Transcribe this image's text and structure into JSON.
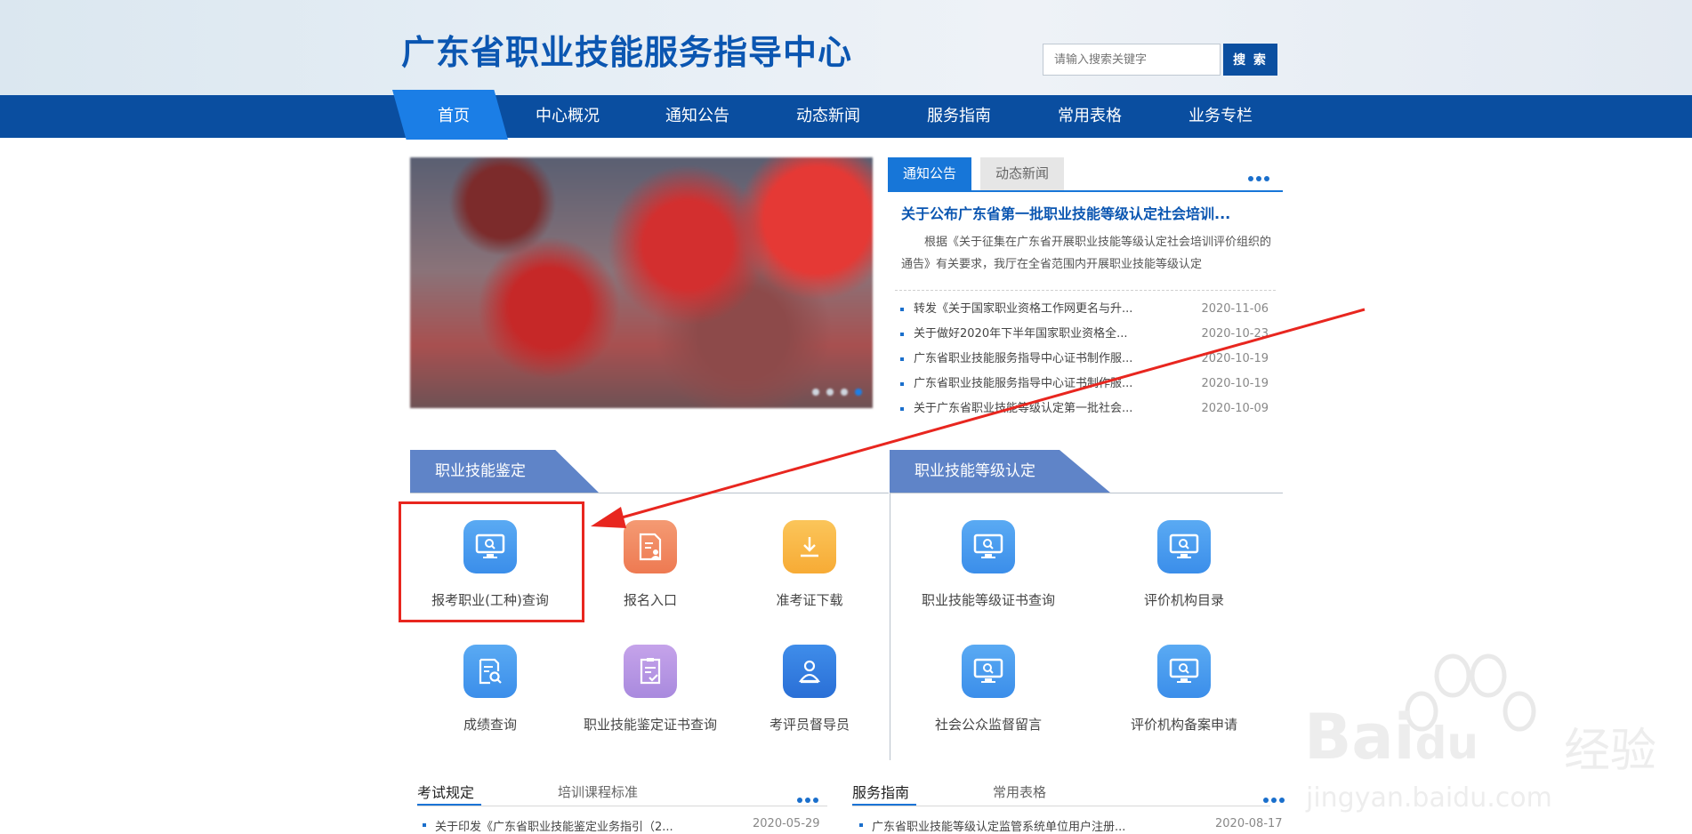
{
  "header": {
    "site_title": "广东省职业技能服务指导中心",
    "search_placeholder": "请输入搜索关键字",
    "search_button": "搜 索"
  },
  "nav": {
    "items": [
      "首页",
      "中心概况",
      "通知公告",
      "动态新闻",
      "服务指南",
      "常用表格",
      "业务专栏"
    ],
    "active_index": 0
  },
  "banner": {
    "slide_count": 4,
    "active_slide": 3
  },
  "notices": {
    "tabs": [
      "通知公告",
      "动态新闻"
    ],
    "active_tab": 0,
    "feature_title": "关于公布广东省第一批职业技能等级认定社会培训...",
    "feature_summary": "根据《关于征集在广东省开展职业技能等级认定社会培训评价组织的通告》有关要求，我厅在全省范围内开展职业技能等级认定",
    "items": [
      {
        "title": "转发《关于国家职业资格工作网更名与升...",
        "date": "2020-11-06"
      },
      {
        "title": "关于做好2020年下半年国家职业资格全...",
        "date": "2020-10-23"
      },
      {
        "title": "广东省职业技能服务指导中心证书制作服...",
        "date": "2020-10-19"
      },
      {
        "title": "广东省职业技能服务指导中心证书制作服...",
        "date": "2020-10-19"
      },
      {
        "title": "关于广东省职业技能等级认定第一批社会...",
        "date": "2020-10-09"
      }
    ]
  },
  "sections": {
    "left_title": "职业技能鉴定",
    "right_title": "职业技能等级认定",
    "left_services": [
      {
        "label": "报考职业(工种)查询",
        "icon": "monitor-search-icon",
        "color": "blue"
      },
      {
        "label": "报名入口",
        "icon": "document-icon",
        "color": "orange"
      },
      {
        "label": "准考证下载",
        "icon": "download-icon",
        "color": "yellow"
      },
      {
        "label": "成绩查询",
        "icon": "document-search-icon",
        "color": "blue"
      },
      {
        "label": "职业技能鉴定证书查询",
        "icon": "certificate-check-icon",
        "color": "purple"
      },
      {
        "label": "考评员督导员",
        "icon": "person-icon",
        "color": "deepblue"
      }
    ],
    "right_services": [
      {
        "label": "职业技能等级证书查询",
        "icon": "monitor-search-icon",
        "color": "blue"
      },
      {
        "label": "评价机构目录",
        "icon": "monitor-search-icon",
        "color": "blue"
      },
      {
        "label": "社会公众监督留言",
        "icon": "monitor-search-icon",
        "color": "blue"
      },
      {
        "label": "评价机构备案申请",
        "icon": "monitor-search-icon",
        "color": "blue"
      }
    ]
  },
  "bottom": {
    "left_tabs": [
      "考试规定",
      "培训课程标准"
    ],
    "right_tabs": [
      "服务指南",
      "常用表格"
    ],
    "left_item": {
      "title": "关于印发《广东省职业技能鉴定业务指引（2...",
      "date": "2020-05-29"
    },
    "right_item": {
      "title": "广东省职业技能等级认定监管系统单位用户注册...",
      "date": "2020-08-17"
    }
  },
  "watermark": {
    "brand": "Bai",
    "brand_suffix": "du",
    "product": "经验",
    "url": "jingyan.baidu.com"
  },
  "colors": {
    "brand": "#0b56b1",
    "nav": "#0a4ea0",
    "nav_active": "#1b7ee6",
    "highlight": "#e8261f"
  }
}
